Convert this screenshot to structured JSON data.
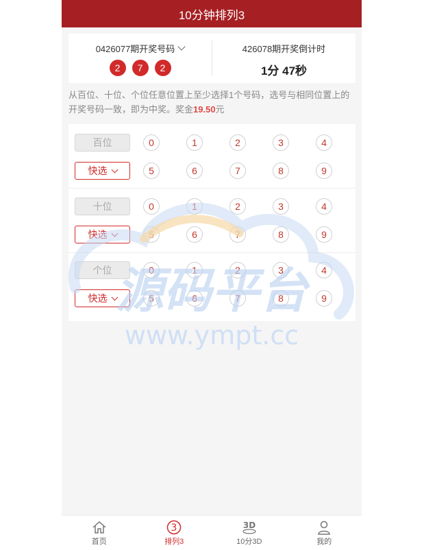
{
  "header": {
    "title": "10分钟排列3"
  },
  "last_draw": {
    "issue": "0426077期开奖号码",
    "numbers": [
      "2",
      "7",
      "2"
    ]
  },
  "next_draw": {
    "issue": "426078期开奖倒计时",
    "countdown": "1分 47秒"
  },
  "rules": {
    "text": "从百位、十位、个位任意位置上至少选择1个号码，选号与相同位置上的开奖号码一致，即为中奖。奖金",
    "prize": "19.50",
    "unit": "元"
  },
  "picker": {
    "quick_label": "快选",
    "digits_top": [
      "0",
      "1",
      "2",
      "3",
      "4"
    ],
    "digits_bottom": [
      "5",
      "6",
      "7",
      "8",
      "9"
    ],
    "positions": [
      {
        "label": "百位"
      },
      {
        "label": "十位"
      },
      {
        "label": "个位"
      }
    ]
  },
  "watermark": {
    "title": "源码平台",
    "url": "www.ympt.cc"
  },
  "nav": [
    {
      "label": "首页",
      "icon": "home-icon"
    },
    {
      "label": "排列3",
      "icon": "circled-three-icon"
    },
    {
      "label": "10分3D",
      "icon": "3d-icon"
    },
    {
      "label": "我的",
      "icon": "user-icon"
    }
  ],
  "colors": {
    "header_bg": "#a61f22",
    "accent": "#d12a2a",
    "prize": "#e04a4a"
  }
}
